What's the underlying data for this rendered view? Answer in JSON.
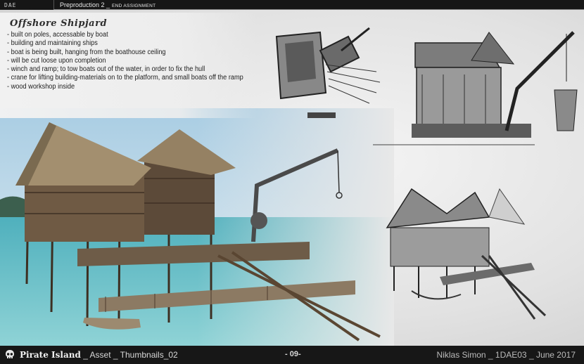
{
  "header": {
    "logo": "DAE",
    "title": "Preproduction 2 _",
    "subtitle": "END ASSIGNMENT"
  },
  "panel": {
    "title": "Offshore Shipjard",
    "bullets": [
      "- built on poles, accessable by boat",
      "- building and maintaining ships",
      "- boat is being built, hanging from the boathouse ceiling",
      "- will be cut loose upon completion",
      "- winch and ramp; to tow boats out of the water, in order to fix the hull",
      "- crane for lifting building-materials on to the platform,  and small boats off the ramp",
      "- wood workshop inside"
    ]
  },
  "footer": {
    "island": "Pirate Island",
    "asset": " _ Asset _ Thumbnails_02",
    "page": "- 09-",
    "credit": "Niklas Simon _ 1DAE03 _  June 2017"
  },
  "icons": {
    "skull": "skull-icon"
  },
  "colors": {
    "bar": "#171717",
    "sea": "#5fb7c4",
    "sky": "#cfe3f0"
  }
}
